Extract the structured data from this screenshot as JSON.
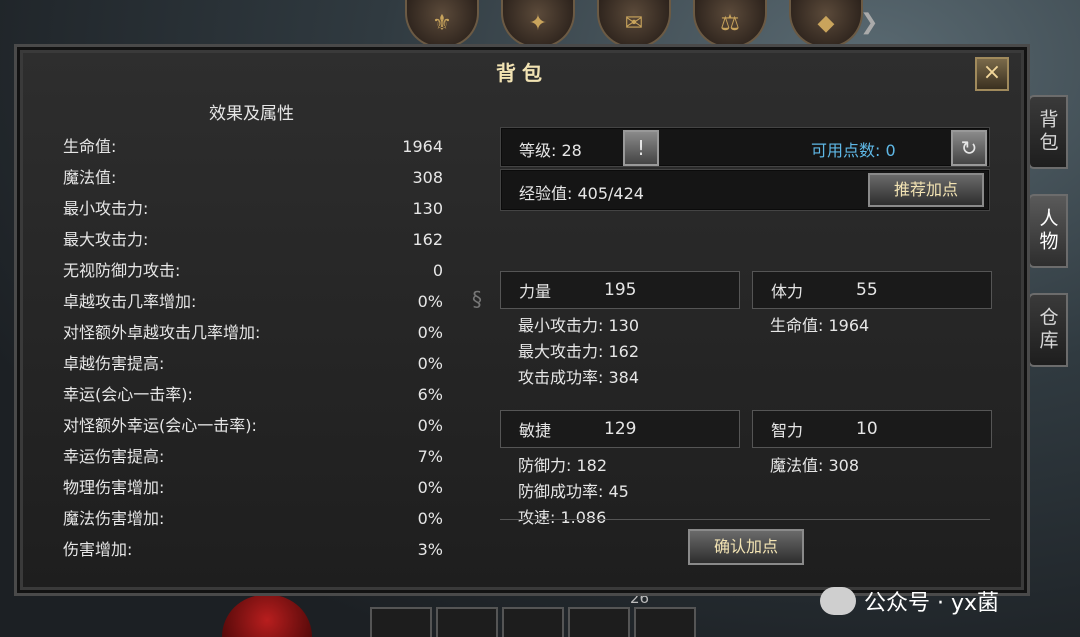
{
  "window": {
    "title": "背包",
    "close_icon": "×"
  },
  "side_tabs": [
    "背包",
    "人物",
    "仓库"
  ],
  "left": {
    "header": "效果及属性",
    "stats": [
      {
        "label": "生命值:",
        "value": "1964"
      },
      {
        "label": "魔法值:",
        "value": "308"
      },
      {
        "label": "最小攻击力:",
        "value": "130"
      },
      {
        "label": "最大攻击力:",
        "value": "162"
      },
      {
        "label": "无视防御力攻击:",
        "value": "0"
      },
      {
        "label": "卓越攻击几率增加:",
        "value": "0%"
      },
      {
        "label": "对怪额外卓越攻击几率增加:",
        "value": "0%"
      },
      {
        "label": "卓越伤害提高:",
        "value": "0%"
      },
      {
        "label": "幸运(会心一击率):",
        "value": "6%"
      },
      {
        "label": "对怪额外幸运(会心一击率):",
        "value": "0%"
      },
      {
        "label": "幸运伤害提高:",
        "value": "7%"
      },
      {
        "label": "物理伤害增加:",
        "value": "0%"
      },
      {
        "label": "魔法伤害增加:",
        "value": "0%"
      },
      {
        "label": "伤害增加:",
        "value": "3%"
      }
    ]
  },
  "right": {
    "level_label": "等级: 28",
    "points_label": "可用点数: 0",
    "exp_label": "经验值: 405/424",
    "recommend_button": "推荐加点",
    "confirm_button": "确认加点",
    "attrs": {
      "strength": {
        "name": "力量",
        "value": "195",
        "details": [
          "最小攻击力: 130",
          "最大攻击力: 162",
          "攻击成功率: 384"
        ]
      },
      "vitality": {
        "name": "体力",
        "value": "55",
        "details": [
          "生命值: 1964"
        ]
      },
      "agility": {
        "name": "敏捷",
        "value": "129",
        "details": [
          "防御力: 182",
          "防御成功率: 45",
          "攻速: 1.086"
        ]
      },
      "energy": {
        "name": "智力",
        "value": "10",
        "details": [
          "魔法值: 308"
        ]
      }
    }
  },
  "bottom": {
    "number": "26"
  },
  "watermark": "公众号 · yx菌"
}
